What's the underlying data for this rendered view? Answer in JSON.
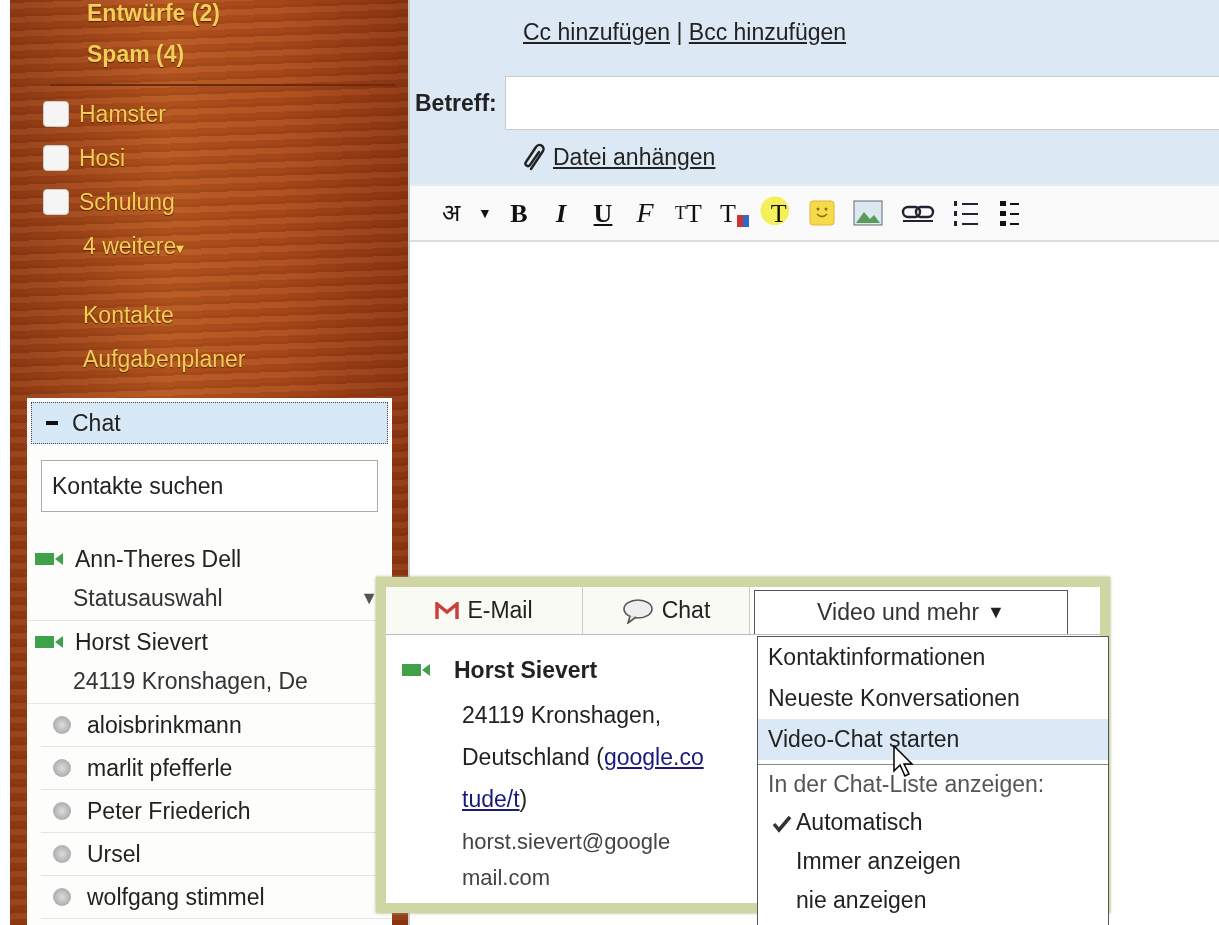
{
  "sidebar": {
    "folders": [
      {
        "label": "Entwürfe (2)",
        "bold": true
      },
      {
        "label": "Spam (4)",
        "bold": true
      }
    ],
    "labels": [
      {
        "name": "Hamster"
      },
      {
        "name": "Hosi"
      },
      {
        "name": "Schulung"
      }
    ],
    "more_labels": "4 weitere",
    "more_caret": "▾",
    "links": [
      "Kontakte",
      "Aufgabenplaner"
    ]
  },
  "chat": {
    "title": "Chat",
    "expanded": true,
    "search": {
      "placeholder": "Kontakte suchen"
    },
    "contacts": [
      {
        "name": "Ann-Theres Dell",
        "kind": "video",
        "subtitle": "Statusauswahl",
        "caret": "▼"
      },
      {
        "name": "Horst Sievert",
        "kind": "video",
        "subtitle": "24119 Kronshagen, De"
      },
      {
        "name": "aloisbrinkmann",
        "kind": "offline"
      },
      {
        "name": "marlit pfefferle",
        "kind": "offline"
      },
      {
        "name": "Peter Friederich",
        "kind": "offline"
      },
      {
        "name": "Ursel",
        "kind": "offline"
      },
      {
        "name": "wolfgang stimmel",
        "kind": "offline"
      }
    ]
  },
  "compose": {
    "cc_link": "Cc hinzufügen",
    "separator": "|",
    "bcc_link": "Bcc hinzufügen",
    "subject_label": "Betreff:",
    "attach_link": "Datei anhängen",
    "toolbar": [
      {
        "kind": "script",
        "text": "अ"
      },
      {
        "kind": "caret",
        "text": "▼"
      },
      {
        "kind": "bold",
        "text": "B"
      },
      {
        "kind": "italic",
        "text": "I"
      },
      {
        "kind": "underline",
        "text": "U"
      },
      {
        "kind": "font",
        "text": "F"
      },
      {
        "kind": "size",
        "small": "T",
        "large": "T"
      },
      {
        "kind": "text-color",
        "text": "T"
      },
      {
        "kind": "highlight",
        "text": "T"
      },
      {
        "kind": "emoji"
      },
      {
        "kind": "image"
      },
      {
        "kind": "link"
      },
      {
        "kind": "numbered-list"
      },
      {
        "kind": "bullet-list"
      }
    ]
  },
  "contact_card": {
    "tabs": [
      {
        "label": "E-Mail",
        "kind": "mail",
        "selected": false
      },
      {
        "label": "Chat",
        "kind": "chat",
        "selected": false
      },
      {
        "label": "Video und mehr",
        "kind": "menu",
        "caret": "▼",
        "selected": true
      }
    ],
    "name": "Horst Sievert",
    "address_lines": [
      [
        {
          "kind": "text",
          "text": "24119 Kronshagen,"
        }
      ],
      [
        {
          "kind": "text",
          "text": "Deutschland ("
        },
        {
          "kind": "link",
          "text": "google.co"
        }
      ],
      [
        {
          "kind": "link",
          "text": "tude/t"
        },
        {
          "kind": "text",
          "text": ")"
        }
      ]
    ],
    "email_lines": [
      "horst.sievert@google",
      "mail.com"
    ],
    "menu": [
      {
        "kind": "item",
        "label": "Kontaktinformationen",
        "selected": false
      },
      {
        "kind": "item",
        "label": "Neueste Konversationen",
        "selected": false
      },
      {
        "kind": "item",
        "label": "Video-Chat starten",
        "selected": true
      },
      {
        "kind": "divider"
      },
      {
        "kind": "header",
        "label": "In der Chat-Liste anzeigen:"
      },
      {
        "kind": "option",
        "label": "Automatisch",
        "checked": true
      },
      {
        "kind": "option",
        "label": "Immer anzeigen",
        "checked": false
      },
      {
        "kind": "option",
        "label": "nie anzeigen",
        "checked": false
      }
    ]
  }
}
